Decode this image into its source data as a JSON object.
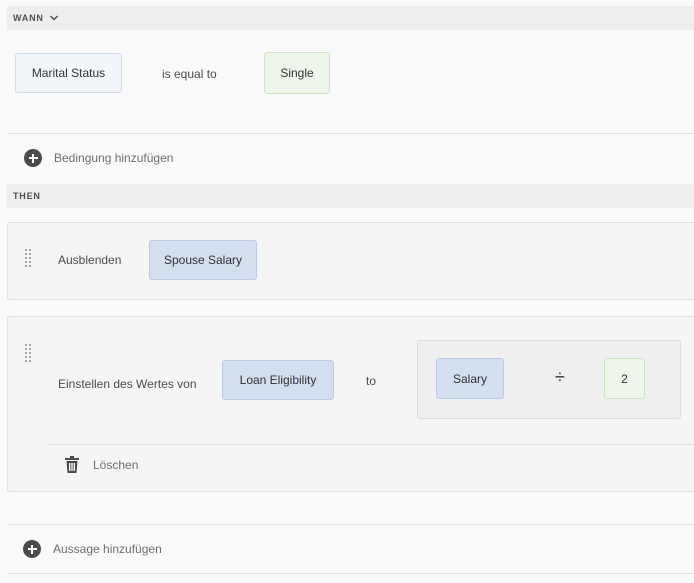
{
  "when": {
    "header": "WANN",
    "condition": {
      "field": "Marital Status",
      "operator": "is equal to",
      "value": "Single"
    },
    "add_condition": "Bedingung hinzufügen"
  },
  "then": {
    "header": "THEN",
    "actions": [
      {
        "action": "Ausblenden",
        "target": "Spouse Salary"
      },
      {
        "action": "Einstellen des Wertes von",
        "target": "Loan Eligibility",
        "connector": "to",
        "expression": {
          "operand_left": "Salary",
          "operator": "÷",
          "operand_right": "2"
        },
        "delete_label": "Löschen"
      }
    ],
    "add_statement": "Aussage hinzufügen"
  },
  "icons": {
    "header_toggle": "chevron-down-icon",
    "add": "plus-circle-icon",
    "drag": "drag-handle-icon",
    "delete": "trash-icon"
  }
}
